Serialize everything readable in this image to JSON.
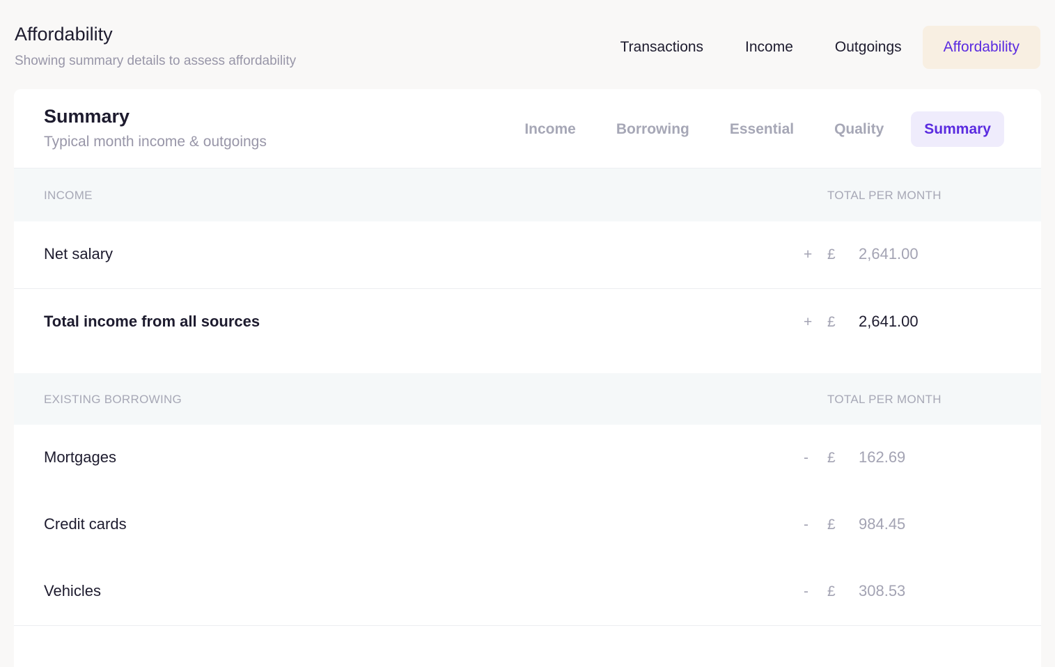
{
  "header": {
    "title": "Affordability",
    "subtitle": "Showing summary details to assess affordability"
  },
  "top_tabs": [
    {
      "label": "Transactions",
      "active": false
    },
    {
      "label": "Income",
      "active": false
    },
    {
      "label": "Outgoings",
      "active": false
    },
    {
      "label": "Affordability",
      "active": true
    }
  ],
  "card": {
    "title": "Summary",
    "subtitle": "Typical month income & outgoings",
    "tabs": [
      {
        "label": "Income",
        "active": false
      },
      {
        "label": "Borrowing",
        "active": false
      },
      {
        "label": "Essential",
        "active": false
      },
      {
        "label": "Quality",
        "active": false
      },
      {
        "label": "Summary",
        "active": true
      }
    ]
  },
  "income_section": {
    "label": "INCOME",
    "column": "TOTAL PER MONTH",
    "rows": [
      {
        "label": "Net salary",
        "sign": "+",
        "currency": "£",
        "amount": "2,641.00"
      }
    ],
    "total": {
      "label": "Total income from all sources",
      "sign": "+",
      "currency": "£",
      "amount": "2,641.00"
    }
  },
  "borrowing_section": {
    "label": "EXISTING BORROWING",
    "column": "TOTAL PER MONTH",
    "rows": [
      {
        "label": "Mortgages",
        "sign": "-",
        "currency": "£",
        "amount": "162.69"
      },
      {
        "label": "Credit cards",
        "sign": "-",
        "currency": "£",
        "amount": "984.45"
      },
      {
        "label": "Vehicles",
        "sign": "-",
        "currency": "£",
        "amount": "308.53"
      }
    ]
  },
  "colors": {
    "accent": "#5a2be0",
    "top_tab_active_bg": "#f8efe2",
    "sub_tab_active_bg": "#efecfc",
    "section_bg": "#f5f8f9"
  }
}
